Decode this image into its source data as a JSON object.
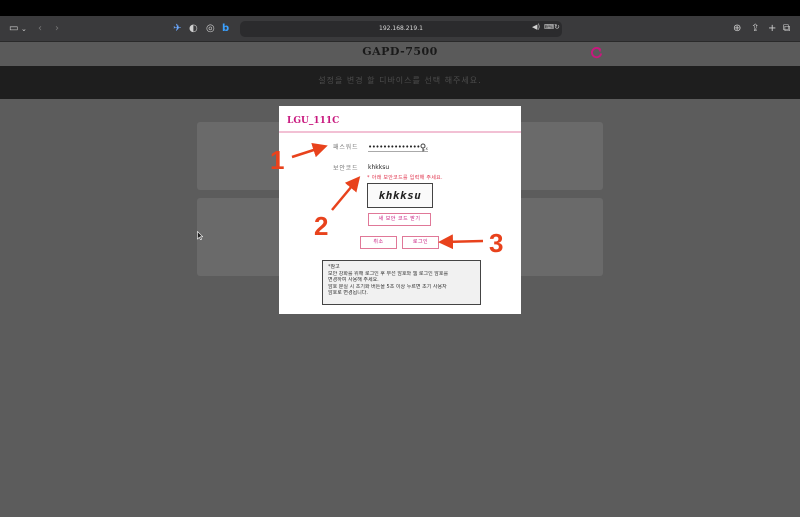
{
  "browser": {
    "url": "192.168.219.1",
    "icons": [
      "sidebar-icon",
      "chevron-down-icon",
      "back-icon",
      "forward-icon",
      "extension-icon",
      "privacy-icon",
      "tab-icon",
      "bing-icon",
      "speaker-icon",
      "translate-icon",
      "reload-icon",
      "download-icon",
      "share-icon",
      "new-tab-icon",
      "tab-overview-icon"
    ]
  },
  "app": {
    "title": "GAPD-7500",
    "notice": "설정을 변경 할 디바이스를 선택 해주세요."
  },
  "modal": {
    "title": "LGU_111C",
    "password_label": "패스워드",
    "password_value": "••••••••••••••",
    "captcha_label": "보안코드",
    "captcha_value": "khkksu",
    "captcha_warning": "* 아래 보안코드를 입력해 주세요.",
    "captcha_image_text": "khkksu",
    "new_captcha_button": "새 보안 코드 받기",
    "cancel_button": "취소",
    "login_button": "로그인",
    "note_lines": [
      "*참고",
      "보안 강화를 위해 로그인 후 무선 암호와 웹 로그인 암호를",
      "변경하여 사용해 주세요.",
      "암호 분실 시 초기화 버튼을 5초 이상 누르면 초기 사용자",
      "암호로 변경됩니다."
    ]
  },
  "annotations": {
    "one": "1",
    "two": "2",
    "three": "3"
  },
  "colors": {
    "accent": "#c8187e",
    "annotation": "#e8421c",
    "warning": "#e0304a"
  }
}
